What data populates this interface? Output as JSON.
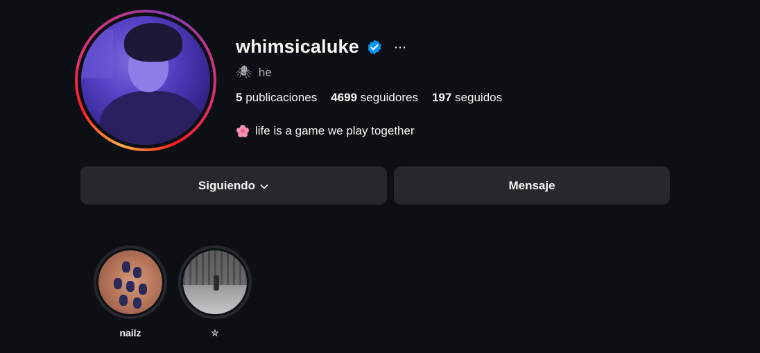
{
  "profile": {
    "username": "whimsicaluke",
    "verified": true,
    "pronoun_emoji": "🕷",
    "pronouns": "he",
    "stats": {
      "posts_count": "5",
      "posts_label": "publicaciones",
      "followers_count": "4699",
      "followers_label": "seguidores",
      "following_count": "197",
      "following_label": "seguidos"
    },
    "bio": "life is a game we play together"
  },
  "actions": {
    "following_label": "Siguiendo",
    "message_label": "Mensaje"
  },
  "highlights": [
    {
      "label": "nailz"
    },
    {
      "label": "✮"
    }
  ],
  "colors": {
    "background": "#0c1014",
    "button": "#25292e",
    "verified": "#0095f6",
    "text_secondary": "#a8a8a8"
  }
}
